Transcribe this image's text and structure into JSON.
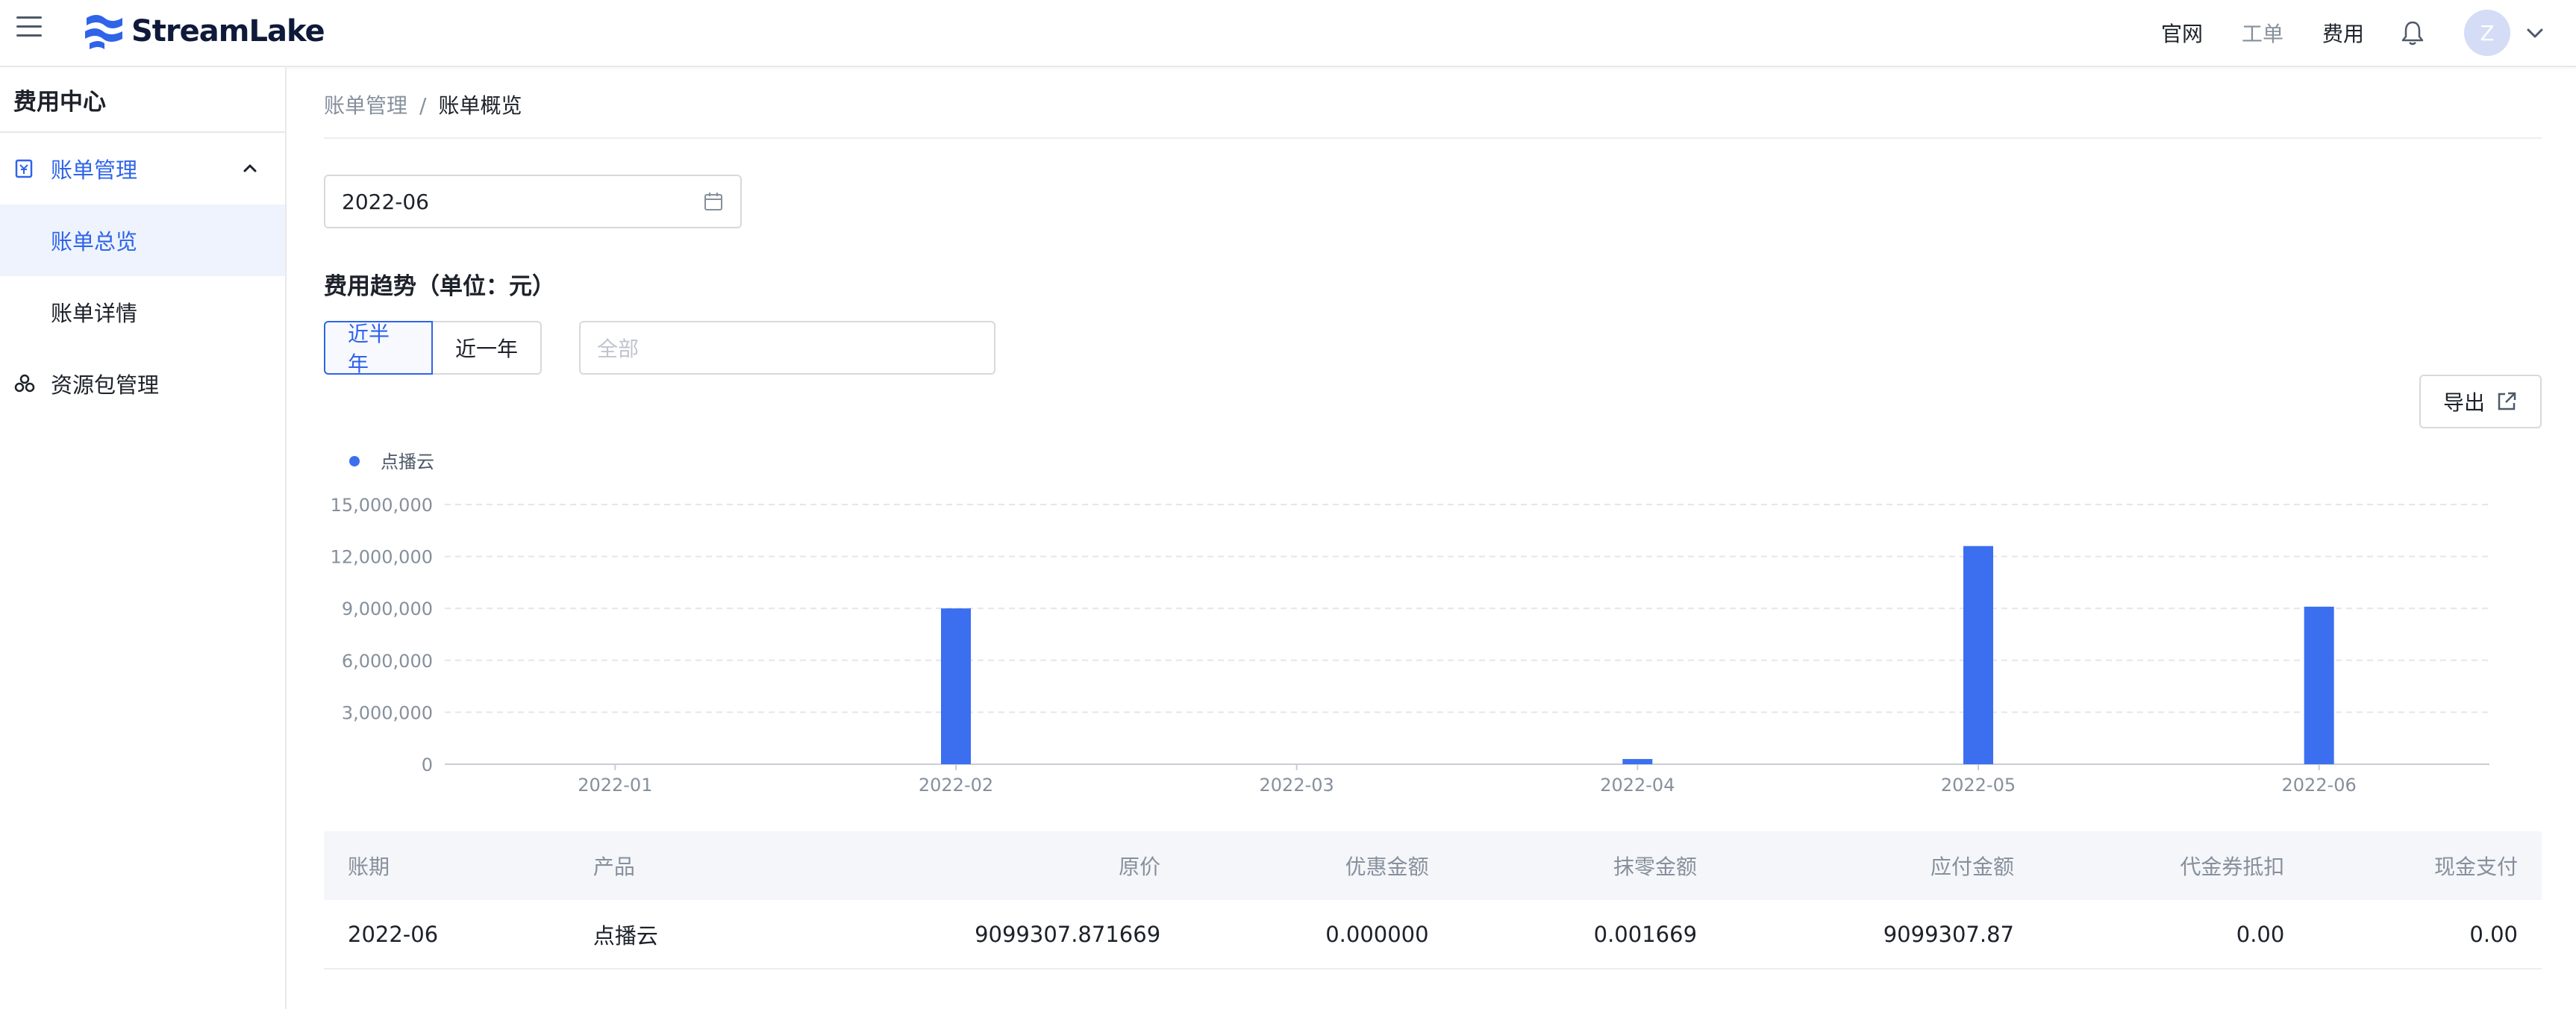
{
  "header": {
    "brand": "StreamLake",
    "nav": [
      "官网",
      "工单",
      "费用"
    ],
    "avatar_initial": "Z"
  },
  "sidebar": {
    "title": "费用中心",
    "group": {
      "label": "账单管理",
      "expanded": true
    },
    "items": [
      {
        "label": "账单总览",
        "active": true
      },
      {
        "label": "账单详情",
        "active": false
      }
    ],
    "package": {
      "label": "资源包管理"
    }
  },
  "breadcrumb": {
    "parent": "账单管理",
    "sep": "/",
    "current": "账单概览"
  },
  "filters": {
    "month": "2022-06",
    "range_options": [
      "近半年",
      "近一年"
    ],
    "range_selected": "近半年",
    "product_placeholder": "全部"
  },
  "section_title": "费用趋势（单位：元）",
  "export_label": "导出",
  "chart_data": {
    "type": "bar",
    "categories": [
      "2022-01",
      "2022-02",
      "2022-03",
      "2022-04",
      "2022-05",
      "2022-06"
    ],
    "series": [
      {
        "name": "点播云",
        "values": [
          0,
          9000000,
          0,
          300000,
          12600000,
          9099307.87
        ]
      }
    ],
    "ylim": [
      0,
      15000000
    ],
    "yticks": [
      0,
      3000000,
      6000000,
      9000000,
      12000000,
      15000000
    ],
    "ytick_labels": [
      "0",
      "3,000,000",
      "6,000,000",
      "9,000,000",
      "12,000,000",
      "15,000,000"
    ],
    "color": "#3b6ff0",
    "legend_position": "top-left",
    "grid": true
  },
  "table": {
    "columns": [
      "账期",
      "产品",
      "原价",
      "优惠金额",
      "抹零金额",
      "应付金额",
      "代金券抵扣",
      "现金支付"
    ],
    "rows": [
      [
        "2022-06",
        "点播云",
        "9099307.871669",
        "0.000000",
        "0.001669",
        "9099307.87",
        "0.00",
        "0.00"
      ]
    ]
  }
}
